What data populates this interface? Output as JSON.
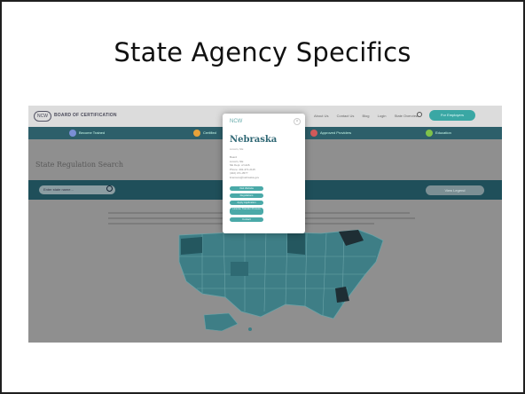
{
  "slide": {
    "title": "State Agency Specifics"
  },
  "site": {
    "logo_badge": "NCW",
    "logo_text": "BOARD OF CERTIFICATION",
    "nav_links": [
      "About Us",
      "Contact Us",
      "Blog",
      "Login",
      "State Overview"
    ],
    "cta_label": "For Employers",
    "band_items": [
      {
        "label": "Become Trained",
        "dot_color": "#7a8fd6"
      },
      {
        "label": "Certified",
        "dot_color": "#e8a23a"
      },
      {
        "label": "Approved Providers",
        "dot_color": "#d25a5a"
      },
      {
        "label": "Education",
        "dot_color": "#7fc24a"
      }
    ],
    "page_heading": "State Regulation Search",
    "search_placeholder": "Enter state name...",
    "filter_label": "View Legend"
  },
  "modal": {
    "logo": "NCW",
    "close": "×",
    "state_name": "Nebraska",
    "subtitle": "Lincoln, NE",
    "info_lines": "Board\nLincoln, NE\nNE Dept. of HHS\nPhone: 402-471-2115\n(402) 471-3577\nlicensure@nebraska.gov",
    "buttons": [
      "Visit Website",
      "Regulations",
      "Apply Application",
      "License Transfer Process",
      "Contact"
    ]
  }
}
